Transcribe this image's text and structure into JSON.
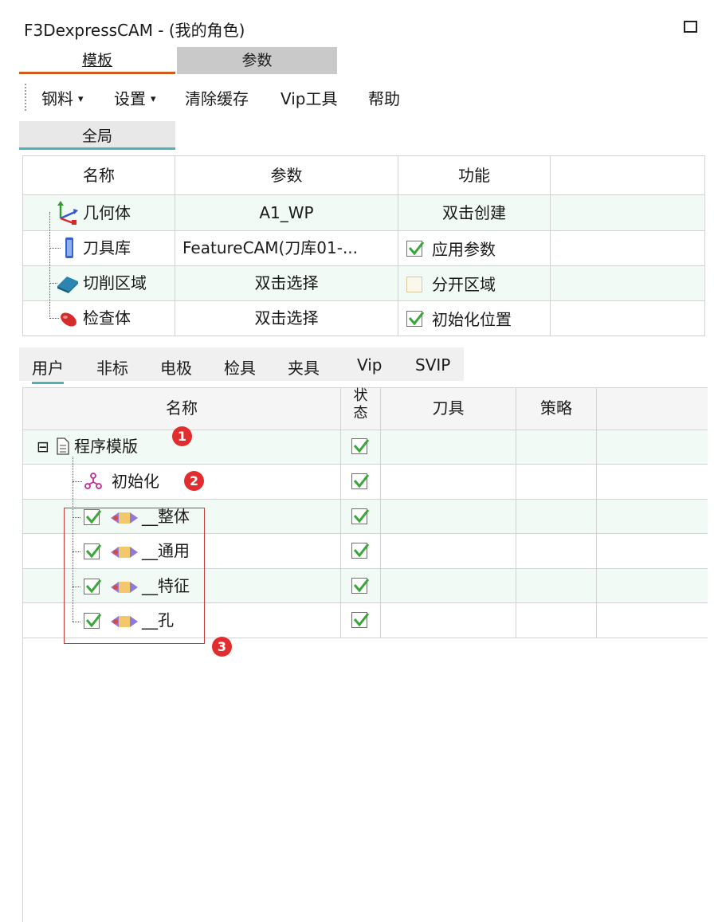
{
  "window": {
    "title": "F3DexpressCAM - (我的角色)"
  },
  "top_tabs": [
    "模板",
    "参数"
  ],
  "menu": [
    {
      "label": "钢料",
      "caret": "▾"
    },
    {
      "label": "设置",
      "caret": "▾"
    },
    {
      "label": "清除缓存"
    },
    {
      "label": "Vip工具"
    },
    {
      "label": "帮助"
    }
  ],
  "scope_tab": "全局",
  "global_table": {
    "headers": [
      "名称",
      "参数",
      "功能"
    ],
    "rows": [
      {
        "name": "几何体",
        "param": "A1_WP",
        "func": "双击创建",
        "icon": "axes-icon"
      },
      {
        "name": "刀具库",
        "param": "FeatureCAM(刀库01-...",
        "func": "应用参数",
        "checked": true,
        "icon": "tool-library-icon"
      },
      {
        "name": "切削区域",
        "param": "双击选择",
        "func": "分开区域",
        "checked": false,
        "icon": "cut-area-icon"
      },
      {
        "name": "检查体",
        "param": "双击选择",
        "func": "初始化位置",
        "checked": true,
        "icon": "check-body-icon"
      }
    ]
  },
  "user_tabs": [
    "用户",
    "非标",
    "电极",
    "检具",
    "夹具",
    "Vip",
    "SVIP"
  ],
  "program_table": {
    "headers": {
      "name": "名称",
      "status": "状\n态",
      "tool": "刀具",
      "strategy": "策略"
    },
    "rows": [
      {
        "name": "程序模版",
        "marker": "1",
        "collapse": "⊟"
      },
      {
        "name": "初始化",
        "marker": "2"
      },
      {
        "name": "__整体"
      },
      {
        "name": "__通用"
      },
      {
        "name": "__特征"
      },
      {
        "name": "__孔"
      }
    ],
    "group_marker": "3"
  },
  "colors": {
    "accent_orange": "#d35a1e",
    "accent_teal": "#4db2ba",
    "check_green": "#3aa63a",
    "marker_red": "#e12d2d"
  }
}
